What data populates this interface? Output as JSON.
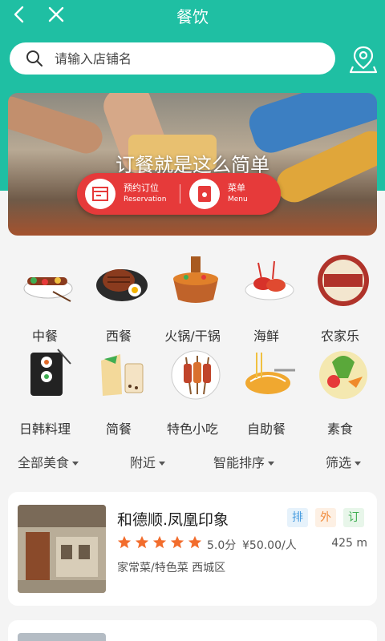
{
  "header": {
    "title": "餐饮",
    "back_icon": "chevron-left-icon",
    "close_icon": "close-icon",
    "bg_color": "#1fbfa3"
  },
  "search": {
    "placeholder": "请输入店铺名",
    "icon": "search-icon",
    "map_icon": "map-pin-icon"
  },
  "banner": {
    "slogan": "订餐就是这么简单",
    "buttons": [
      {
        "label": "预约订位",
        "sub": "Reservation",
        "icon": "reservation-icon"
      },
      {
        "label": "菜单",
        "sub": "Menu",
        "icon": "menu-icon"
      }
    ],
    "accent": "#e63a3a"
  },
  "categories": [
    {
      "label": "中餐",
      "icon": "bbq-skewer-icon"
    },
    {
      "label": "西餐",
      "icon": "steak-icon"
    },
    {
      "label": "火锅/干锅",
      "icon": "hotpot-icon"
    },
    {
      "label": "海鲜",
      "icon": "crayfish-icon"
    },
    {
      "label": "农家乐",
      "icon": "farmhouse-icon"
    },
    {
      "label": "日韩料理",
      "icon": "sushi-icon"
    },
    {
      "label": "简餐",
      "icon": "wrap-drink-icon"
    },
    {
      "label": "特色小吃",
      "icon": "snack-skewers-icon"
    },
    {
      "label": "自助餐",
      "icon": "noodles-icon"
    },
    {
      "label": "素食",
      "icon": "vegetables-icon"
    }
  ],
  "filters": [
    {
      "label": "全部美食"
    },
    {
      "label": "附近"
    },
    {
      "label": "智能排序"
    },
    {
      "label": "筛选"
    }
  ],
  "restaurants": [
    {
      "name": "和德顺.凤凰印象",
      "rating": 5,
      "score": "5.0分",
      "price": "¥50.00/人",
      "distance": "425 m",
      "categories": "家常菜/特色菜  西城区",
      "tags": [
        {
          "label": "排",
          "color": "#4a9ee0",
          "bg": "#e6f2fb"
        },
        {
          "label": "外",
          "color": "#f08a3a",
          "bg": "#fdf0e4"
        },
        {
          "label": "订",
          "color": "#3fae52",
          "bg": "#e8f6ea"
        }
      ]
    }
  ],
  "colors": {
    "star": "#f26d2d",
    "teal": "#1fbfa3"
  }
}
